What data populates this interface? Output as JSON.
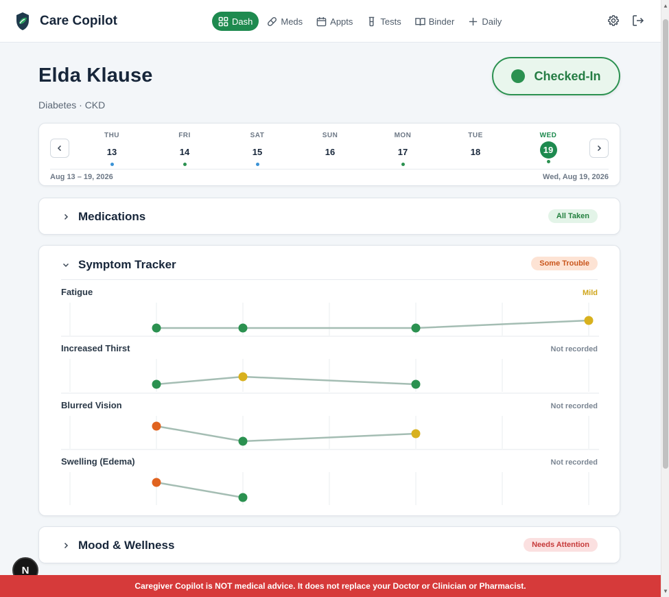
{
  "app": {
    "name": "Care Copilot",
    "logo_icon": "shield-leaf-icon",
    "accent": "#1e8a4f"
  },
  "nav": [
    {
      "label": "Dash",
      "icon": "grid-icon",
      "active": true
    },
    {
      "label": "Meds",
      "icon": "pill-icon",
      "active": false
    },
    {
      "label": "Appts",
      "icon": "calendar-icon",
      "active": false
    },
    {
      "label": "Tests",
      "icon": "flask-icon",
      "active": false
    },
    {
      "label": "Binder",
      "icon": "book-icon",
      "active": false
    },
    {
      "label": "Daily",
      "icon": "plus-icon",
      "active": false
    }
  ],
  "top_icons": [
    "gear-icon",
    "logout-icon"
  ],
  "patient": {
    "name": "Elda Klause",
    "conditions": "Diabetes · CKD"
  },
  "checkin": {
    "label": "Checked-In",
    "color": "#2b9150"
  },
  "calendar": {
    "days": [
      {
        "dow": "THU",
        "num": "13",
        "marker": "#3b93d6",
        "today": false
      },
      {
        "dow": "FRI",
        "num": "14",
        "marker": "#2b9150",
        "today": false
      },
      {
        "dow": "SAT",
        "num": "15",
        "marker": "#3b93d6",
        "today": false
      },
      {
        "dow": "SUN",
        "num": "16",
        "marker": "",
        "today": false
      },
      {
        "dow": "MON",
        "num": "17",
        "marker": "#2b9150",
        "today": false
      },
      {
        "dow": "TUE",
        "num": "18",
        "marker": "",
        "today": false
      },
      {
        "dow": "WED",
        "num": "19",
        "marker": "#2b9150",
        "today": true
      }
    ],
    "range": "Aug 13 – 19, 2026",
    "selected_date": "Wed, Aug 19, 2026"
  },
  "sections": {
    "medications": {
      "title": "Medications",
      "badge": "All Taken",
      "badge_bg": "#e3f4e8",
      "badge_color": "#23803f",
      "expanded": false
    },
    "symptoms": {
      "title": "Symptom Tracker",
      "badge": "Some Trouble",
      "badge_bg": "#fde3d4",
      "badge_color": "#c9561c",
      "expanded": true
    },
    "mood": {
      "title": "Mood & Wellness",
      "badge": "Needs Attention",
      "badge_bg": "#fbe0e0",
      "badge_color": "#c63a3a",
      "expanded": false
    }
  },
  "severity_colors": {
    "none": "#2b9150",
    "mild": "#d8b11e",
    "moderate": "#e0631f"
  },
  "symptoms": [
    {
      "name": "Fatigue",
      "status": "Mild",
      "status_color": "#cfa51a",
      "points": [
        null,
        "none",
        "none",
        null,
        "none",
        null,
        "mild"
      ]
    },
    {
      "name": "Increased Thirst",
      "status": "Not recorded",
      "status_color": "#7a8592",
      "points": [
        null,
        "none",
        "mild",
        null,
        "none",
        null,
        null
      ]
    },
    {
      "name": "Blurred Vision",
      "status": "Not recorded",
      "status_color": "#7a8592",
      "points": [
        null,
        "moderate",
        "none",
        null,
        "mild",
        null,
        null
      ]
    },
    {
      "name": "Swelling (Edema)",
      "status": "Not recorded",
      "status_color": "#7a8592",
      "points": [
        null,
        "moderate",
        "none",
        null,
        null,
        null,
        null
      ]
    }
  ],
  "fab": {
    "label": "N"
  },
  "disclaimer": "Caregiver Copilot is NOT medical advice. It does not replace your Doctor or Clinician or Pharmacist."
}
